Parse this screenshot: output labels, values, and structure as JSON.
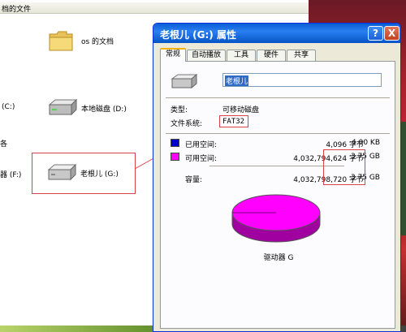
{
  "explorer": {
    "header_text": "档的文件",
    "folder": {
      "label": "os 的文档",
      "icon": "folder-icon"
    },
    "section_label": "各",
    "left_fragments": {
      "c_drive": "(C:)",
      "f_drive": "器 (F:)"
    },
    "drives": [
      {
        "label": "本地磁盘 (D:)",
        "icon": "hard-drive-icon"
      },
      {
        "label": "老根儿 (G:)",
        "icon": "removable-drive-icon"
      }
    ]
  },
  "dialog": {
    "title": "老根儿 (G:) 属性",
    "help_button": "?",
    "close_button": "X",
    "tabs": [
      "常规",
      "自动播放",
      "工具",
      "硬件",
      "共享"
    ],
    "volume_name": "老根儿",
    "type_label": "类型:",
    "type_value": "可移动磁盘",
    "fs_label": "文件系统:",
    "fs_value": "FAT32",
    "used": {
      "label": "已用空间:",
      "bytes": "4,096 字节",
      "size": "4.00 KB",
      "color": "#0000cc"
    },
    "free": {
      "label": "可用空间:",
      "bytes": "4,032,794,624 字节",
      "size": "3.75 GB",
      "color": "#ff00ff"
    },
    "capacity": {
      "label": "容量:",
      "bytes": "4,032,798,720 字节",
      "size": "3.75 GB"
    },
    "drive_caption": "驱动器 G",
    "pie": {
      "free_fraction": 0.999999,
      "used_fraction": 1e-06,
      "free_color": "#ff00ff",
      "shadow_color": "#a000a0"
    }
  },
  "annotation_color": "#d9424a"
}
